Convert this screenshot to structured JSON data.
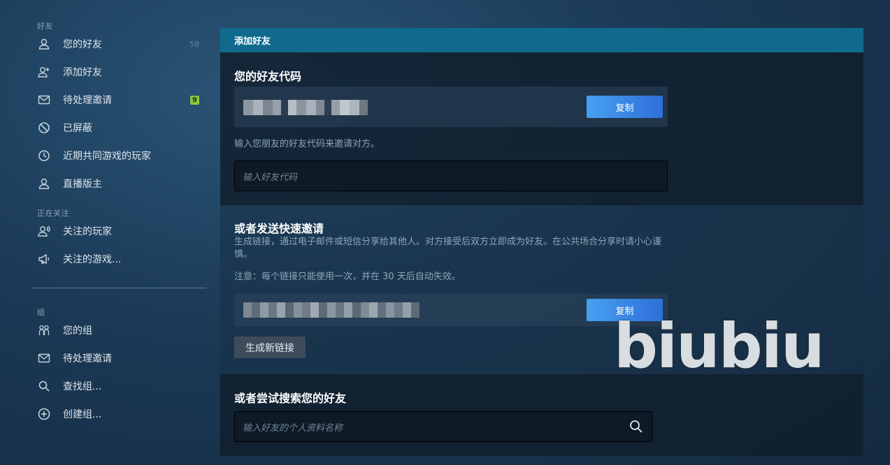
{
  "sidebar": {
    "friends_header": "好友",
    "friends_items": [
      {
        "label": "您的好友",
        "count": "58",
        "icon": "user-icon"
      },
      {
        "label": "添加好友",
        "icon": "add-user-icon"
      },
      {
        "label": "待处理邀请",
        "badge": "9",
        "icon": "envelope-icon"
      },
      {
        "label": "已屏蔽",
        "icon": "blocked-icon"
      },
      {
        "label": "近期共同游戏的玩家",
        "icon": "clock-icon"
      },
      {
        "label": "直播版主",
        "icon": "user-icon"
      }
    ],
    "following_header": "正在关注",
    "following_items": [
      {
        "label": "关注的玩家",
        "icon": "follow-user-icon"
      },
      {
        "label": "关注的游戏...",
        "icon": "megaphone-icon"
      }
    ],
    "groups_header": "组",
    "groups_items": [
      {
        "label": "您的组",
        "icon": "group-icon"
      },
      {
        "label": "待处理邀请",
        "icon": "envelope-icon"
      },
      {
        "label": "查找组...",
        "icon": "search-icon"
      },
      {
        "label": "创建组...",
        "icon": "plus-circle-icon"
      }
    ]
  },
  "panel": {
    "header": "添加好友",
    "friend_code_title": "您的好友代码",
    "copy_label": "复制",
    "friend_code_hint": "输入您朋友的好友代码来邀请对方。",
    "friend_code_placeholder": "输入好友代码",
    "quick_invite_title": "或者发送快速邀请",
    "quick_invite_desc": "生成链接，通过电子邮件或短信分享给其他人。对方接受后双方立即成为好友。在公共场合分享时请小心谨慎。",
    "quick_invite_note": "注意：每个链接只能使用一次，并在 30 天后自动失效。",
    "generate_label": "生成新链接",
    "search_title": "或者尝试搜索您的好友",
    "search_placeholder": "输入好友的个人资料名称"
  },
  "watermark": "biubiu"
}
